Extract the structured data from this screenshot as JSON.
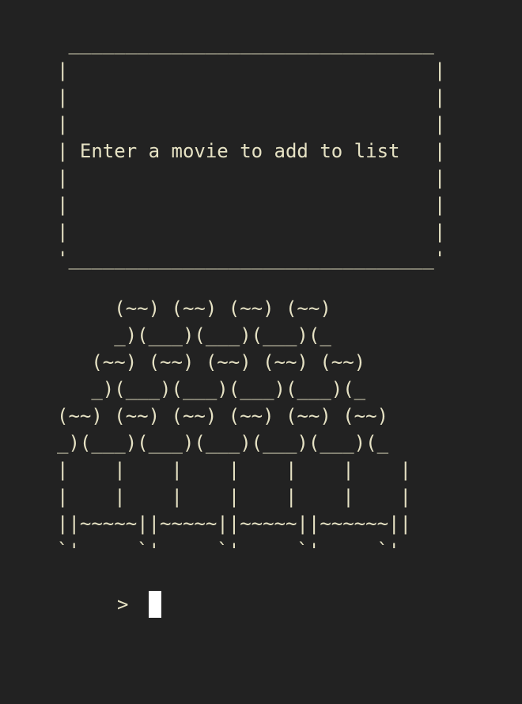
{
  "terminal": {
    "banner": {
      "top_border": " ________________________________",
      "lines": [
        "|                                |",
        "|                                |",
        "|                                |",
        "| Enter a movie to add to list   |",
        "|                                |",
        "|                                |",
        "|                                |",
        "'________________________________'"
      ]
    },
    "popcorn_art": [
      "     (~~) (~~) (~~) (~~)",
      "     _)(___)(___)(___)(_",
      "   (~~) (~~) (~~) (~~) (~~)",
      "   _)(___)(___)(___)(___)(_",
      "(~~) (~~) (~~) (~~) (~~) (~~)",
      "_)(___)(___)(___)(___)(___)(_",
      "|    |    |    |    |    |    |",
      "|    |    |    |    |    |    |",
      "||~~~~~||~~~~~||~~~~~||~~~~~~||",
      "`'     `'     `'     `'     `'"
    ],
    "prompt": {
      "symbol": ">",
      "input_value": ""
    },
    "colors": {
      "background": "#222222",
      "foreground": "#e6e2c4",
      "cursor": "#ffffff"
    }
  }
}
